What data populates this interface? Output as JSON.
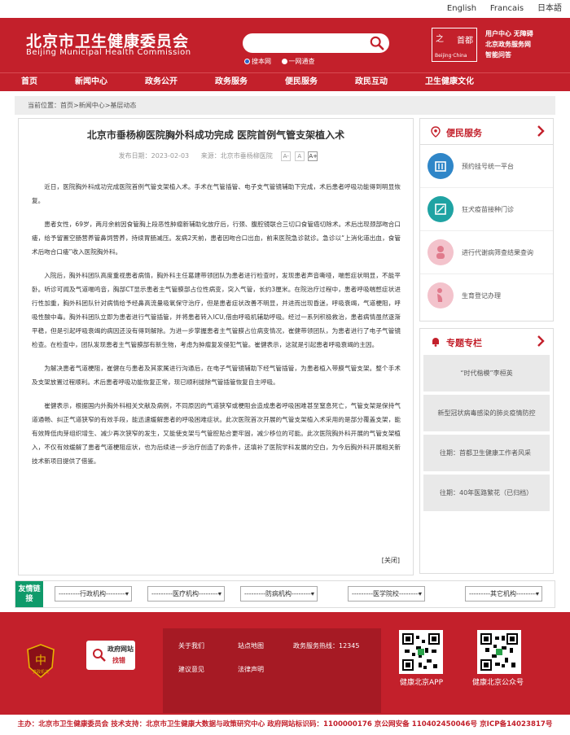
{
  "langbar": {
    "english": "English",
    "french": "Francais",
    "japanese": "日本語"
  },
  "header": {
    "title_cn": "北京市卫生健康委员会",
    "title_en": "Beijing Municipal Health Commission",
    "search_placeholder": "",
    "search_opt_site": "搜本网",
    "search_opt_all": "一网通查",
    "capital_logo": {
      "c1": "之",
      "c2": "首都",
      "c3": "Beijing·China"
    },
    "links": [
      "用户中心  无障碍",
      "北京政务服务网",
      "智能问答"
    ]
  },
  "nav": [
    "首页",
    "新闻中心",
    "政务公开",
    "政务服务",
    "便民服务",
    "政民互动",
    "卫生健康文化"
  ],
  "breadcrumb": "当前位置：首页>新闻中心>基层动态",
  "article": {
    "title": "北京市垂杨柳医院胸外科成功完成 医院首例气管支架植入术",
    "date": "发布日期：2023-02-03",
    "source": "来源：北京市垂杨柳医院",
    "font_sizes": [
      "A-",
      "A",
      "A+"
    ],
    "paragraphs": [
      "近日，医院胸外科成功完成医院首例气管支架植入术。手术在气管插管、电子支气管镜辅助下完成，术后患者呼吸功能得到明显恢复。",
      "患者女性，69岁，两月余前因食管胸上段恶性肿瘤新辅助化放疗后，行颈、腹腔镜联合三切口食管癌切除术。术后出现颈部吻合口瘘，给予留置空肠营养管鼻饲营养，持续胃肠减压。发病2天前，患者因吻合口出血，前来医院急诊就诊。急诊以“上消化道出血，食管术后吻合口瘘”收入医院胸外科。",
      "入院后，胸外科团队高度重视患者病情，胸外科主任葛建带领团队为患者进行检查时，发现患者声音嘶哑，喘憋症状明显，不能平卧。听诊可闻及气道喘鸣音，胸部CT显示患者主气管膜部占位性病变，突入气管，长约3厘米。在院治疗过程中，患者呼吸喘憋症状进行性加重，胸外科团队针对病情给予经鼻高流量吸氧保守治疗，但是患者症状改善不明显，并进而出现昏迷，呼吸衰竭，气道梗阻，呼吸性酸中毒。胸外科团队立即为患者进行气管插管，并将患者转入ICU,借由呼吸机辅助呼吸。经过一系列积极救治，患者病情虽然逐渐平稳，但是引起呼吸衰竭的病因还没有得到解除。为进一步掌握患者主气管膜占位病变情况，崔健带领团队，为患者进行了电子气管镜检查。在检查中，团队发现患者主气管膜部有新生物，考虑为肿瘤复发侵犯气管。崔健表示，这就是引起患者呼吸衰竭的主因。",
      "为解决患者气道梗阻，崔健在与患者及其家属进行沟通后，在电子气管镜辅助下经气管插管，为患者植入带膜气管支架。整个手术及支架放置过程顺利。术后患者呼吸功能恢复正常，现已顺利拔除气管插管恢复自主呼吸。",
      "崔健表示，根据国内外胸外科相关文献及病例，不同原因的气道狭窄或梗阻会造成患者呼吸困难甚至窒息死亡，气管支架是保持气道通畅、纠正气道狭窄的有效手段，能迅速缓解患者的呼吸困难症状。此次医院首次开展的气管支架植入术采用的是部分覆盖支架，能有效降低肉芽组织增生、减少再次狭窄的发生，又能使支架与气管腔贴合更牢固，减少移位的可能。此次医院胸外科开展的气管支架植入，不仅有效缓解了患者气道梗阻症状，也为后续进一步治疗创造了的条件，还填补了医院学科发展的空白，为今后胸外科开展相关新技术新项目提供了借鉴。"
    ],
    "close": "[关闭]"
  },
  "sidebar": {
    "services_title": "便民服务",
    "services": [
      {
        "label": "预约挂号统一平台",
        "color": "#2f86c8"
      },
      {
        "label": "狂犬疫苗接种门诊",
        "color": "#1fa3a3"
      },
      {
        "label": "进行代谢病筛查结果查询",
        "color": "#e07a8c"
      },
      {
        "label": "生育登记办理",
        "color": "#e07a8c"
      }
    ],
    "topics_title": "专题专栏",
    "topics": [
      "“时代楷模”李桓英",
      "新型冠状病毒感染的肺炎疫情防控",
      "往期：首都卫生健康工作者风采",
      "往期：40年医路繁花（已归档）"
    ]
  },
  "friend_links": {
    "badge": "友情链接",
    "selects": [
      "---------行政机构---------",
      "---------医疗机构---------",
      "---------防病机构---------",
      "---------医学院校---------",
      "---------其它机构---------"
    ]
  },
  "footer": {
    "links": [
      "关于我们",
      "站点地图",
      "政务服务热线：12345",
      "建议意见",
      "法律声明"
    ],
    "badge_label": "党政机关",
    "gov_find": [
      "政府网站",
      "找错"
    ],
    "qr_app": "健康北京APP",
    "qr_wechat": "健康北京公众号",
    "bottom": "主办：北京市卫生健康委员会  技术支持：北京市卫生健康大数据与政策研究中心   政府网站标识码：1100000176  京公网安备 110402450046号  京ICP备14023817号"
  }
}
